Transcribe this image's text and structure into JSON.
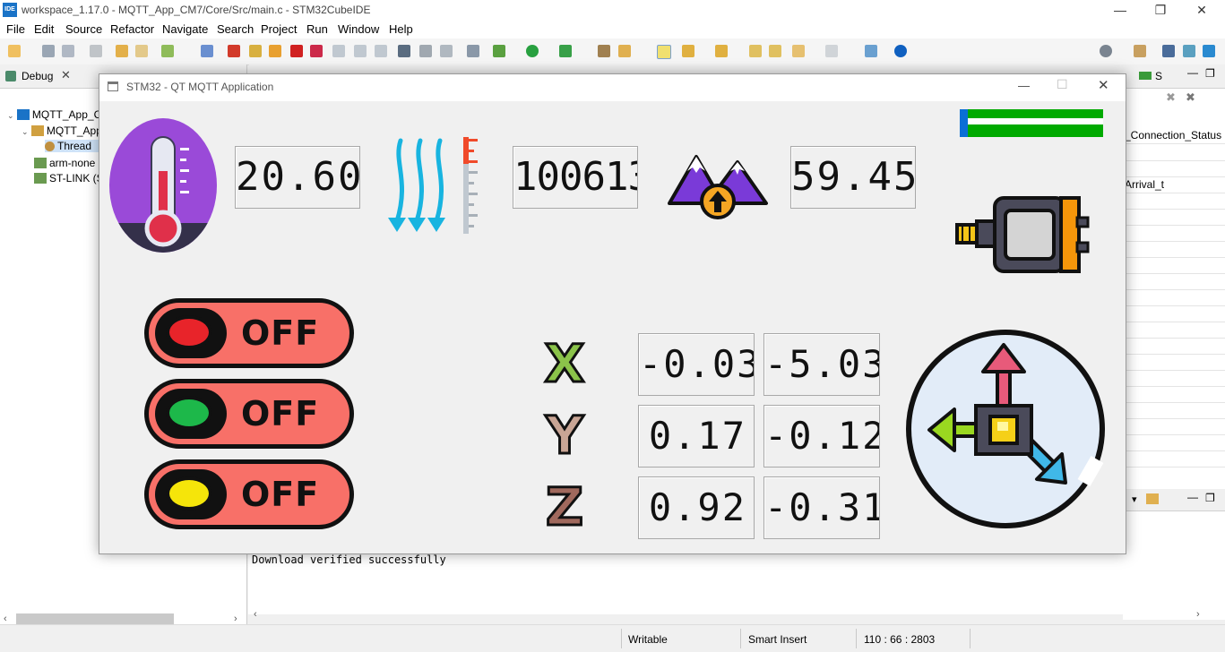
{
  "ide": {
    "logo": "IDE",
    "title": "workspace_1.17.0 - MQTT_App_CM7/Core/Src/main.c - STM32CubeIDE",
    "window_controls": {
      "minimize": "—",
      "maximize": "❐",
      "close": "✕"
    }
  },
  "menu": [
    "File",
    "Edit",
    "Source",
    "Refactor",
    "Navigate",
    "Search",
    "Project",
    "Run",
    "Window",
    "Help"
  ],
  "debug_view": {
    "tab_label": "Debug",
    "tree": [
      "MQTT_App_C",
      "MQTT_App",
      "Thread",
      "arm-none",
      "ST-LINK (S"
    ]
  },
  "right_panel": {
    "tab_label": "S",
    "items": [
      "_Connection_Status",
      "Arrival_t"
    ]
  },
  "console": {
    "line": "Download verified successfully"
  },
  "status_bar": {
    "writable": "Writable",
    "insert_mode": "Smart Insert",
    "position": "110 : 66 : 2803"
  },
  "app": {
    "title": "STM32 - QT MQTT Application",
    "temperature": "20.60",
    "pressure": "100613",
    "altitude": "59.45",
    "leds": [
      {
        "label": "OFF",
        "color": "#e8242a"
      },
      {
        "label": "OFF",
        "color": "#1db84a"
      },
      {
        "label": "OFF",
        "color": "#f5e50a"
      }
    ],
    "axes": [
      {
        "letter": "X",
        "value1": "-0.03",
        "value2": "-5.03",
        "color": "#8bc34a"
      },
      {
        "letter": "Y",
        "value1": "0.17",
        "value2": "-0.12",
        "color": "#c9a595"
      },
      {
        "letter": "Z",
        "value1": "0.92",
        "value2": "-0.31",
        "color": "#a0695d"
      }
    ],
    "connection_bar_color": "#00aa00"
  }
}
